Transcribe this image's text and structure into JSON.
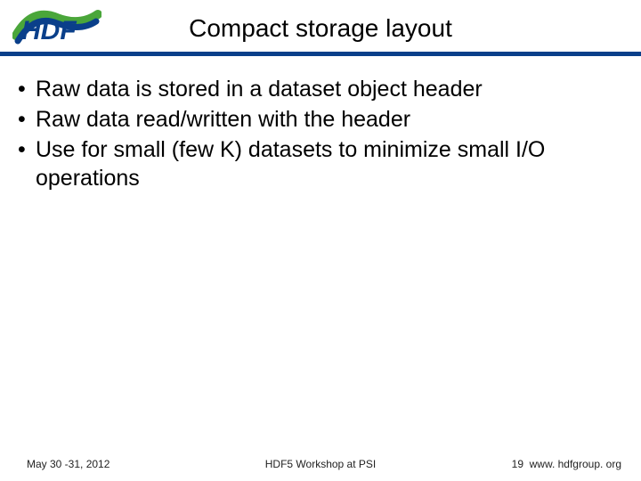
{
  "title": "Compact  storage layout",
  "bullets": [
    "Raw data is stored in a dataset object header",
    "Raw data read/written with the header",
    "Use for small (few K) datasets to minimize small I/O operations"
  ],
  "footer": {
    "date": "May 30 -31, 2012",
    "center": "HDF5 Workshop at PSI",
    "page": "19",
    "url": "www. hdfgroup. org"
  },
  "logo_text": "HDF"
}
